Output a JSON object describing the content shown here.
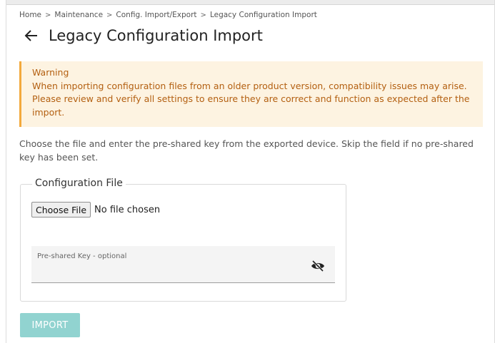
{
  "breadcrumb": {
    "items": [
      "Home",
      "Maintenance",
      "Config. Import/Export",
      "Legacy Configuration Import"
    ],
    "separator": ">"
  },
  "header": {
    "title": "Legacy Configuration Import",
    "back_icon": "arrow-left-icon"
  },
  "warning": {
    "heading": "Warning",
    "message": "When importing configuration files from an older product version, compatibility issues may arise. Please review and verify all settings to ensure they are correct and function as expected after the import.",
    "color": "#b35f10",
    "background": "#fdf3e1",
    "accent": "#f3a93c"
  },
  "instructions": "Choose the file and enter the pre-shared key from the exported device. Skip the field if no pre-shared key has been set.",
  "config_file": {
    "legend": "Configuration File",
    "choose_label": "Choose File",
    "file_status": "No file chosen",
    "psk_label": "Pre-shared Key - optional",
    "psk_value": "",
    "visibility_icon": "eye-off-icon"
  },
  "actions": {
    "import_label": "IMPORT",
    "import_disabled": true,
    "import_color": "#91d3d0"
  }
}
